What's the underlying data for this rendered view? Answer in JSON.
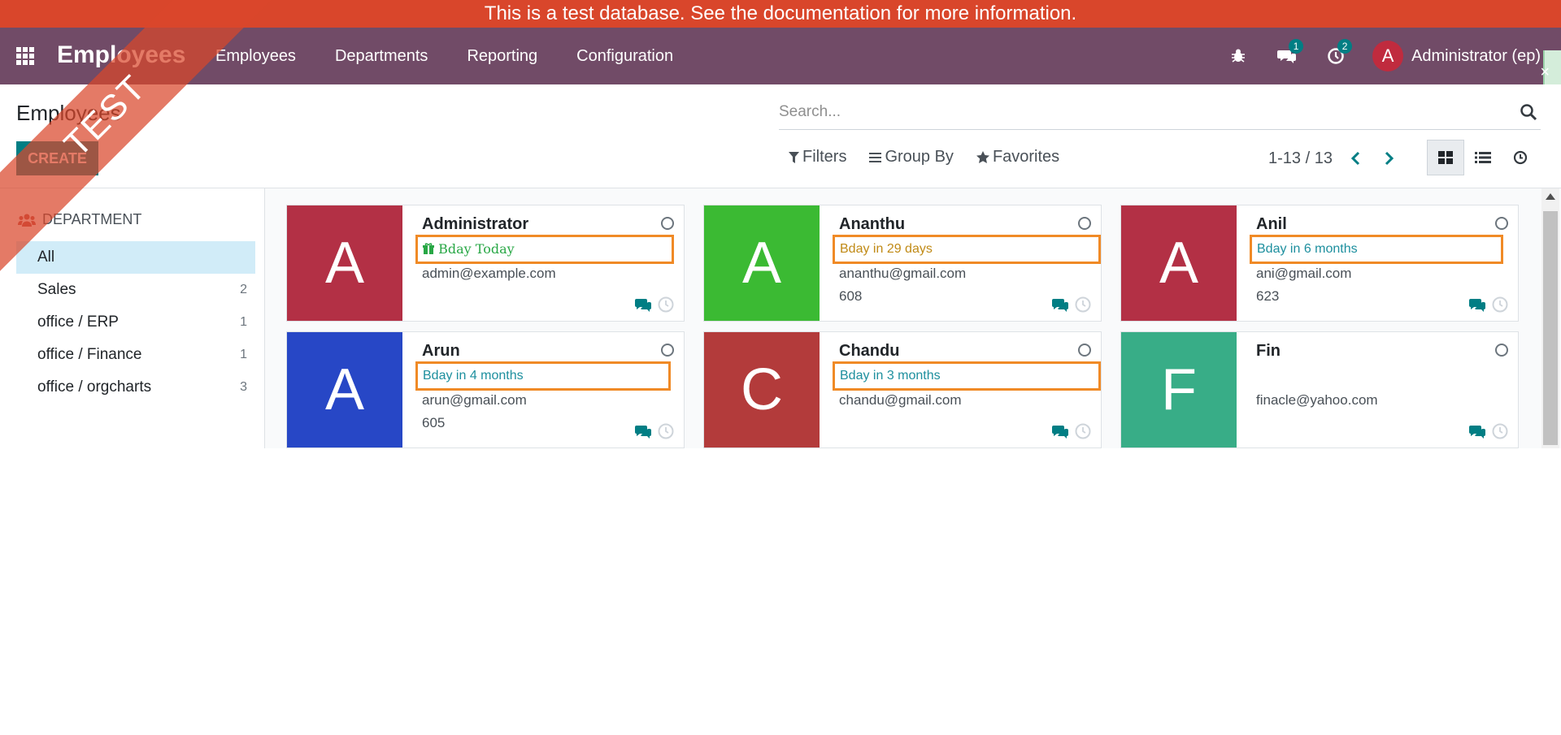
{
  "banner": {
    "text": "This is a test database.",
    "link": "See the documentation for more information."
  },
  "navbar": {
    "brand": "Employees",
    "menu": [
      "Employees",
      "Departments",
      "Reporting",
      "Configuration"
    ],
    "chat_count": "1",
    "activity_count": "2",
    "user_initial": "A",
    "user_name": "Administrator (ep)"
  },
  "watermark": "TEST",
  "control_panel": {
    "title": "Employees",
    "create_label": "CREATE",
    "search_placeholder": "Search...",
    "filters_label": "Filters",
    "groupby_label": "Group By",
    "favorites_label": "Favorites",
    "pager": "1-13 / 13"
  },
  "sidebar": {
    "header": "DEPARTMENT",
    "items": [
      {
        "label": "All",
        "count": ""
      },
      {
        "label": "Sales",
        "count": "2"
      },
      {
        "label": "office / ERP",
        "count": "1"
      },
      {
        "label": "office / Finance",
        "count": "1"
      },
      {
        "label": "office / orgcharts",
        "count": "3"
      }
    ]
  },
  "cards": [
    {
      "initial": "A",
      "color": "#b33045",
      "name": "Administrator",
      "bday": "Bday Today",
      "bday_color": "#28a745",
      "email": "admin@example.com",
      "phone": ""
    },
    {
      "initial": "A",
      "color": "#3bba33",
      "name": "Ananthu",
      "bday": "Bday in 29 days",
      "bday_color": "#c08a16",
      "email": "ananthu@gmail.com",
      "phone": "608"
    },
    {
      "initial": "A",
      "color": "#b33045",
      "name": "Anil",
      "bday": "Bday in 6 months",
      "bday_color": "#1d8f9e",
      "email": "ani@gmail.com",
      "phone": "623"
    },
    {
      "initial": "A",
      "color": "#2747c6",
      "name": "Arun",
      "bday": "Bday in 4 months",
      "bday_color": "#1d8f9e",
      "email": "arun@gmail.com",
      "phone": "605"
    },
    {
      "initial": "C",
      "color": "#b33b3b",
      "name": "Chandu",
      "bday": "Bday in 3 months",
      "bday_color": "#1d8f9e",
      "email": "chandu@gmail.com",
      "phone": ""
    },
    {
      "initial": "F",
      "color": "#38ad87",
      "name": "Fin",
      "bday": "",
      "bday_color": "#1d8f9e",
      "email": "finacle@yahoo.com",
      "phone": ""
    }
  ]
}
